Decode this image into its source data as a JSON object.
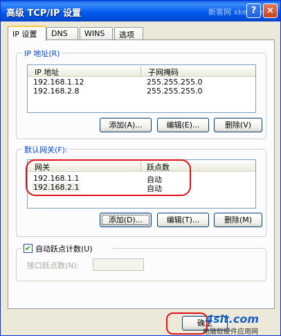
{
  "window": {
    "title": "高级 TCP/IP 设置",
    "watermark": "新客网 xker.com",
    "help_label": "?",
    "close_label": "×"
  },
  "tabs": [
    {
      "label": "IP 设置"
    },
    {
      "label": "DNS"
    },
    {
      "label": "WINS"
    },
    {
      "label": "选项"
    }
  ],
  "ip_section": {
    "label": "IP 地址(R)",
    "columns": [
      "IP 地址",
      "子网掩码"
    ],
    "rows": [
      {
        "ip": "192.168.1.12",
        "mask": "255.255.255.0"
      },
      {
        "ip": "192.168.2.8",
        "mask": "255.255.255.0"
      }
    ],
    "add_label": "添加(A)...",
    "edit_label": "编辑(E)...",
    "delete_label": "删除(V)"
  },
  "gateway_section": {
    "label": "默认网关(F):",
    "columns": [
      "网关",
      "跃点数"
    ],
    "rows": [
      {
        "gateway": "192.168.1.1",
        "metric": "自动"
      },
      {
        "gateway": "192.168.2.1",
        "metric": "自动"
      }
    ],
    "add_label": "添加(D)...",
    "edit_label": "编辑(T)...",
    "delete_label": "删除(M)"
  },
  "auto_metric": {
    "label": "自动跃点计数(U)",
    "checked": true,
    "check_glyph": "✔",
    "interface_metric_label": "接口跃点数(N):",
    "interface_metric_value": ""
  },
  "footer": {
    "ok_label": "确定",
    "logo_text": "4sit.com",
    "logo_subtext": "电脑软硬件应用网"
  }
}
